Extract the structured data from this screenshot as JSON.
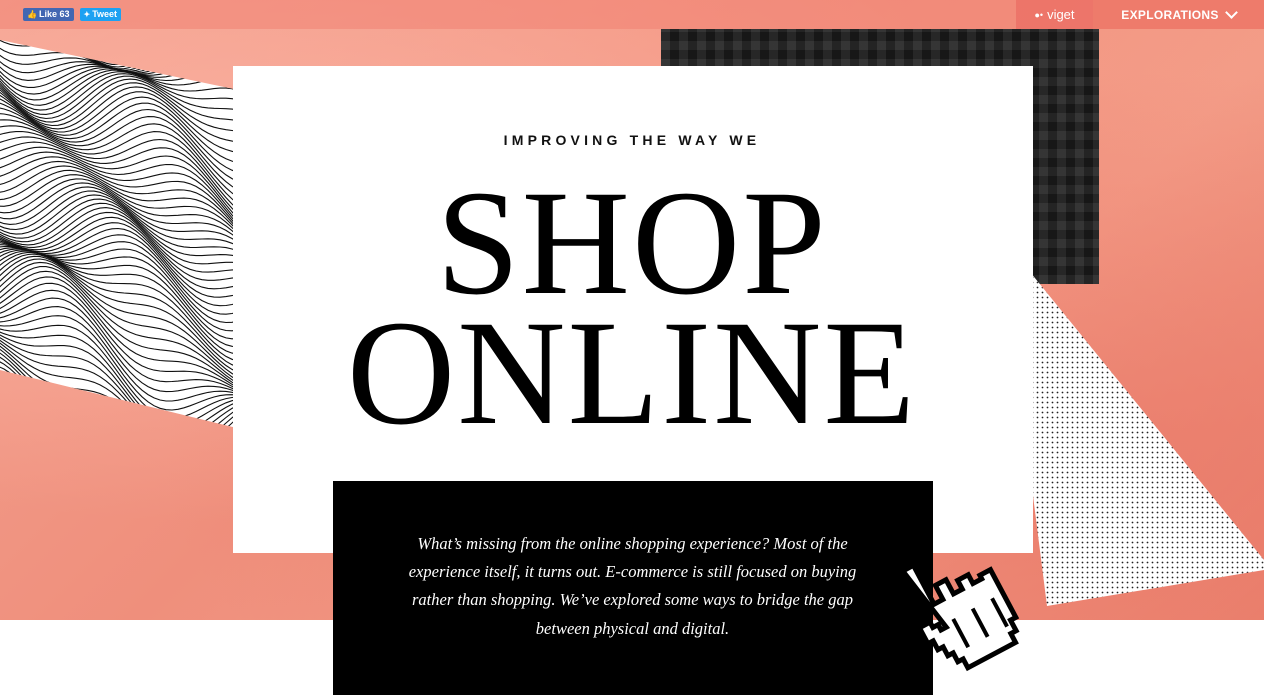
{
  "topbar": {
    "like_label": "Like 63",
    "tweet_label": "Tweet",
    "brand": "viget",
    "nav_label": "EXPLORATIONS"
  },
  "hero": {
    "kicker": "IMPROVING THE WAY WE",
    "headline_line1": "SHOP",
    "headline_line2": "ONLINE",
    "intro": "What’s missing from the online shopping experience? Most of the experience itself, it turns out. E-commerce is still focused on buying rather than shopping. We’ve explored some ways to bridge the gap between physical and digital."
  },
  "icons": {
    "like": "thumbs-up-icon",
    "tweet": "twitter-bird-icon",
    "brand": "viget-logo-icon",
    "nav": "chevron-down-icon",
    "cursor": "hand-pointer-icon"
  },
  "colors": {
    "background": "#f09a86",
    "card": "#ffffff",
    "panel": "#000000",
    "nav_accent": "#ee7b6b",
    "facebook": "#4267b2",
    "twitter": "#1da1f2"
  }
}
